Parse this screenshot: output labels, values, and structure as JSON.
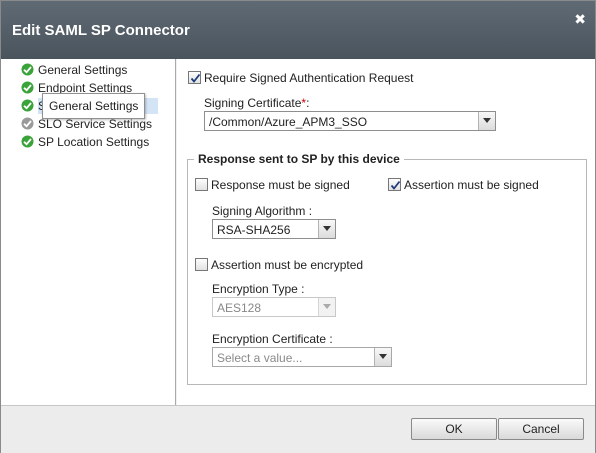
{
  "dialog": {
    "title": "Edit SAML SP Connector"
  },
  "nav": {
    "items": [
      {
        "label": "General Settings",
        "selected": false
      },
      {
        "label": "Endpoint Settings",
        "selected": false
      },
      {
        "label": "S",
        "selected": true
      },
      {
        "label": "SLO Service Settings",
        "selected": false
      },
      {
        "label": "SP Location Settings",
        "selected": false
      }
    ],
    "tooltip": "General Settings"
  },
  "content": {
    "require_signed_auth": {
      "label": "Require Signed Authentication Request",
      "checked": true
    },
    "signing_certificate": {
      "label": "Signing Certificate",
      "required_mark": "*",
      "colon": ":",
      "value": "/Common/Azure_APM3_SSO"
    },
    "response_group": {
      "legend": "Response sent to SP by this device",
      "response_signed": {
        "label": "Response must be signed",
        "checked": false
      },
      "assertion_signed": {
        "label": "Assertion must be signed",
        "checked": true
      },
      "signing_algorithm": {
        "label": "Signing Algorithm :",
        "value": "RSA-SHA256"
      },
      "assertion_encrypted": {
        "label": "Assertion must be encrypted",
        "checked": false
      },
      "encryption_type": {
        "label": "Encryption Type :",
        "value": "AES128",
        "disabled": true
      },
      "encryption_certificate": {
        "label": "Encryption Certificate :",
        "placeholder": "Select a value...",
        "disabled": true
      }
    }
  },
  "footer": {
    "ok_label": "OK",
    "cancel_label": "Cancel"
  },
  "colors": {
    "titlebar": "#4f5962",
    "check_green": "#3aa33a",
    "required": "#cc0000"
  }
}
